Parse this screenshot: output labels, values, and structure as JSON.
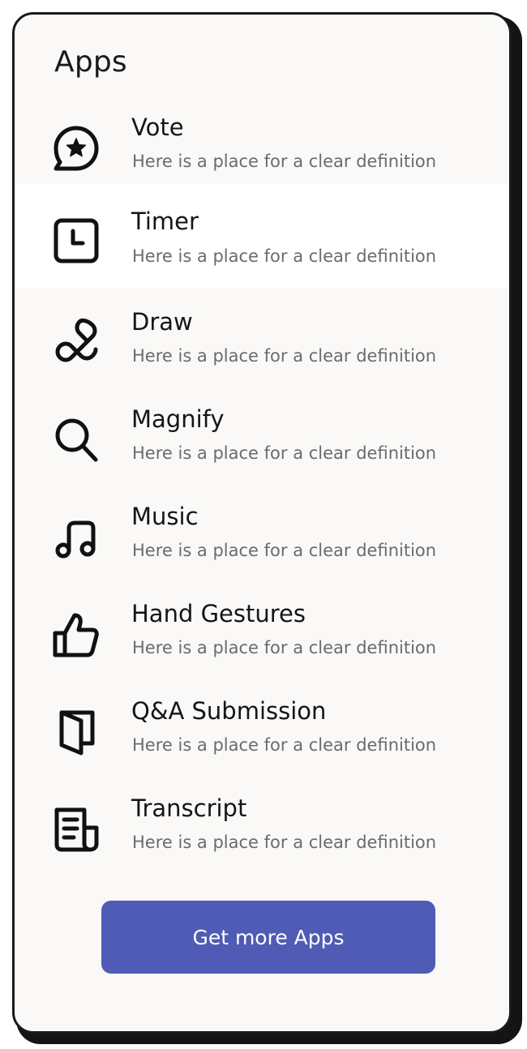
{
  "panel": {
    "title": "Apps"
  },
  "apps": [
    {
      "name": "Vote",
      "description": "Here is a place for a clear definition",
      "icon": "vote-icon",
      "selected": false
    },
    {
      "name": "Timer",
      "description": "Here is a place for a clear definition",
      "icon": "timer-icon",
      "selected": true
    },
    {
      "name": "Draw",
      "description": "Here is a place for a clear definition",
      "icon": "draw-icon",
      "selected": false
    },
    {
      "name": "Magnify",
      "description": "Here is a place for a clear definition",
      "icon": "magnify-icon",
      "selected": false
    },
    {
      "name": "Music",
      "description": "Here is a place for a clear definition",
      "icon": "music-icon",
      "selected": false
    },
    {
      "name": "Hand Gestures",
      "description": "Here is a place for a clear definition",
      "icon": "thumbs-up-icon",
      "selected": false
    },
    {
      "name": "Q&A Submission",
      "description": "Here is a place for a clear definition",
      "icon": "book-icon",
      "selected": false
    },
    {
      "name": "Transcript",
      "description": "Here is a place for a clear definition",
      "icon": "transcript-icon",
      "selected": false
    }
  ],
  "cta": {
    "label": "Get more Apps"
  },
  "colors": {
    "accent": "#4f5bb5",
    "panel_background": "#faf9f7",
    "selected_background": "#ffffff",
    "text_primary": "#151515",
    "text_secondary": "#6b6b6b"
  }
}
